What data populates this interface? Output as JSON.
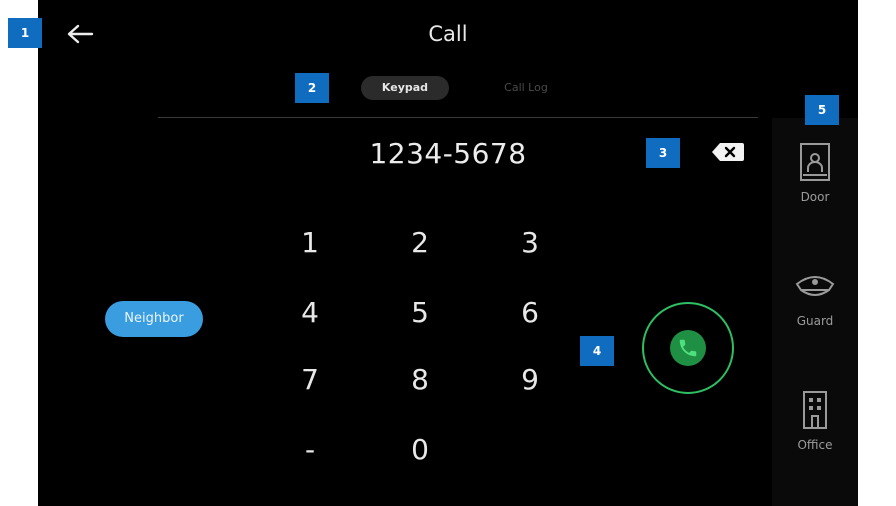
{
  "header": {
    "title": "Call"
  },
  "tabs": [
    {
      "label": "Keypad",
      "active": true
    },
    {
      "label": "Call Log",
      "active": false
    }
  ],
  "dialer": {
    "number": "1234-5678",
    "keys": [
      "1",
      "2",
      "3",
      "4",
      "5",
      "6",
      "7",
      "8",
      "9",
      "-",
      "0"
    ]
  },
  "contact_button": {
    "label": "Neighbor"
  },
  "sidebar": {
    "items": [
      {
        "label": "Door",
        "icon": "door-icon"
      },
      {
        "label": "Guard",
        "icon": "guard-icon"
      },
      {
        "label": "Office",
        "icon": "office-building-icon"
      }
    ]
  },
  "markers": [
    "1",
    "2",
    "3",
    "4",
    "5"
  ],
  "colors": {
    "background": "#000000",
    "accent_blue": "#3a9de0",
    "call_green": "#2fbf63",
    "marker_blue": "#0f6cbf"
  }
}
